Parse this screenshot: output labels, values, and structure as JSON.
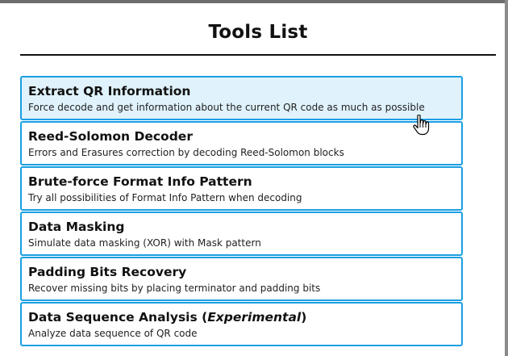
{
  "page": {
    "title": "Tools List"
  },
  "tools": [
    {
      "name": "Extract QR Information",
      "name_suffix": "",
      "name_italic": "",
      "name_close": "",
      "description": "Force decode and get information about the current QR code as much as possible",
      "hovered": true
    },
    {
      "name": "Reed-Solomon Decoder",
      "name_suffix": "",
      "name_italic": "",
      "name_close": "",
      "description": "Errors and Erasures correction by decoding Reed-Solomon blocks",
      "hovered": false
    },
    {
      "name": "Brute-force Format Info Pattern",
      "name_suffix": "",
      "name_italic": "",
      "name_close": "",
      "description": "Try all possibilities of Format Info Pattern when decoding",
      "hovered": false
    },
    {
      "name": "Data Masking",
      "name_suffix": "",
      "name_italic": "",
      "name_close": "",
      "description": "Simulate data masking (XOR) with Mask pattern",
      "hovered": false
    },
    {
      "name": "Padding Bits Recovery",
      "name_suffix": "",
      "name_italic": "",
      "name_close": "",
      "description": "Recover missing bits by placing terminator and padding bits",
      "hovered": false
    },
    {
      "name": "Data Sequence Analysis (",
      "name_suffix": "",
      "name_italic": "Experimental",
      "name_close": ")",
      "description": "Analyze data sequence of QR code",
      "hovered": false
    }
  ],
  "colors": {
    "accent_border": "#1a9fe3",
    "hover_background": "#e0f2fc"
  },
  "icons": {
    "cursor": "hand-pointer-icon"
  }
}
